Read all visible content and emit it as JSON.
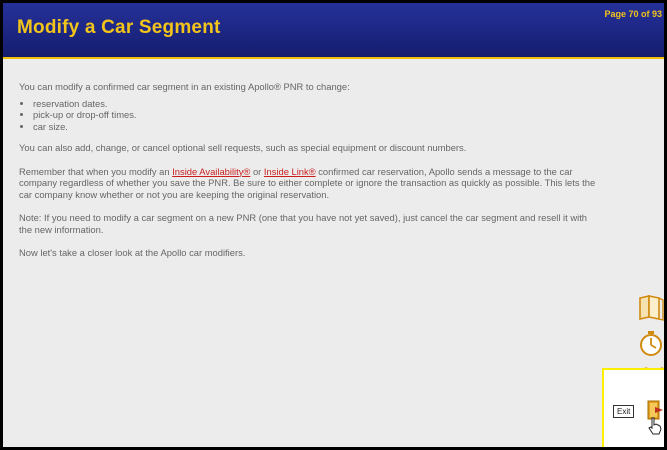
{
  "header": {
    "title": "Modify a Car Segment",
    "page_indicator": "Page 70 of 93"
  },
  "content": {
    "intro": "You can modify a confirmed car segment in an existing Apollo® PNR to change:",
    "bullets": [
      "reservation dates.",
      "pick-up or drop-off times.",
      "car size."
    ],
    "para2": "You can also add, change, or cancel optional sell requests, such as special equipment or discount numbers.",
    "para3_part1": "Remember that when you modify an ",
    "link1": "Inside Availability®",
    "para3_part2": " or ",
    "link2": "Inside Link®",
    "para3_part3": " confirmed car reservation, Apollo sends a message to the car company regardless of whether you save the PNR. Be sure to either complete or ignore the transaction as quickly as possible. This lets the car company know whether or not you are keeping the original reservation.",
    "para4": "Note: If you need to modify a car segment on a new PNR (one that you have not yet saved), just cancel the car segment and resell it with the new information.",
    "para5": "Now let's take a closer look at the Apollo car modifiers."
  },
  "side_icons": {
    "book": "book-icon",
    "timer": "stopwatch-icon",
    "search": "magnifier-map-icon",
    "exit": "exit-door-icon"
  },
  "exit": {
    "label": "Exit"
  },
  "colors": {
    "header_bg": "#1a2480",
    "title": "#f3c41a",
    "accent_gold": "#e0a020",
    "body_text": "#666666",
    "link": "#c81e1e",
    "exit_highlight": "#ffef00"
  }
}
